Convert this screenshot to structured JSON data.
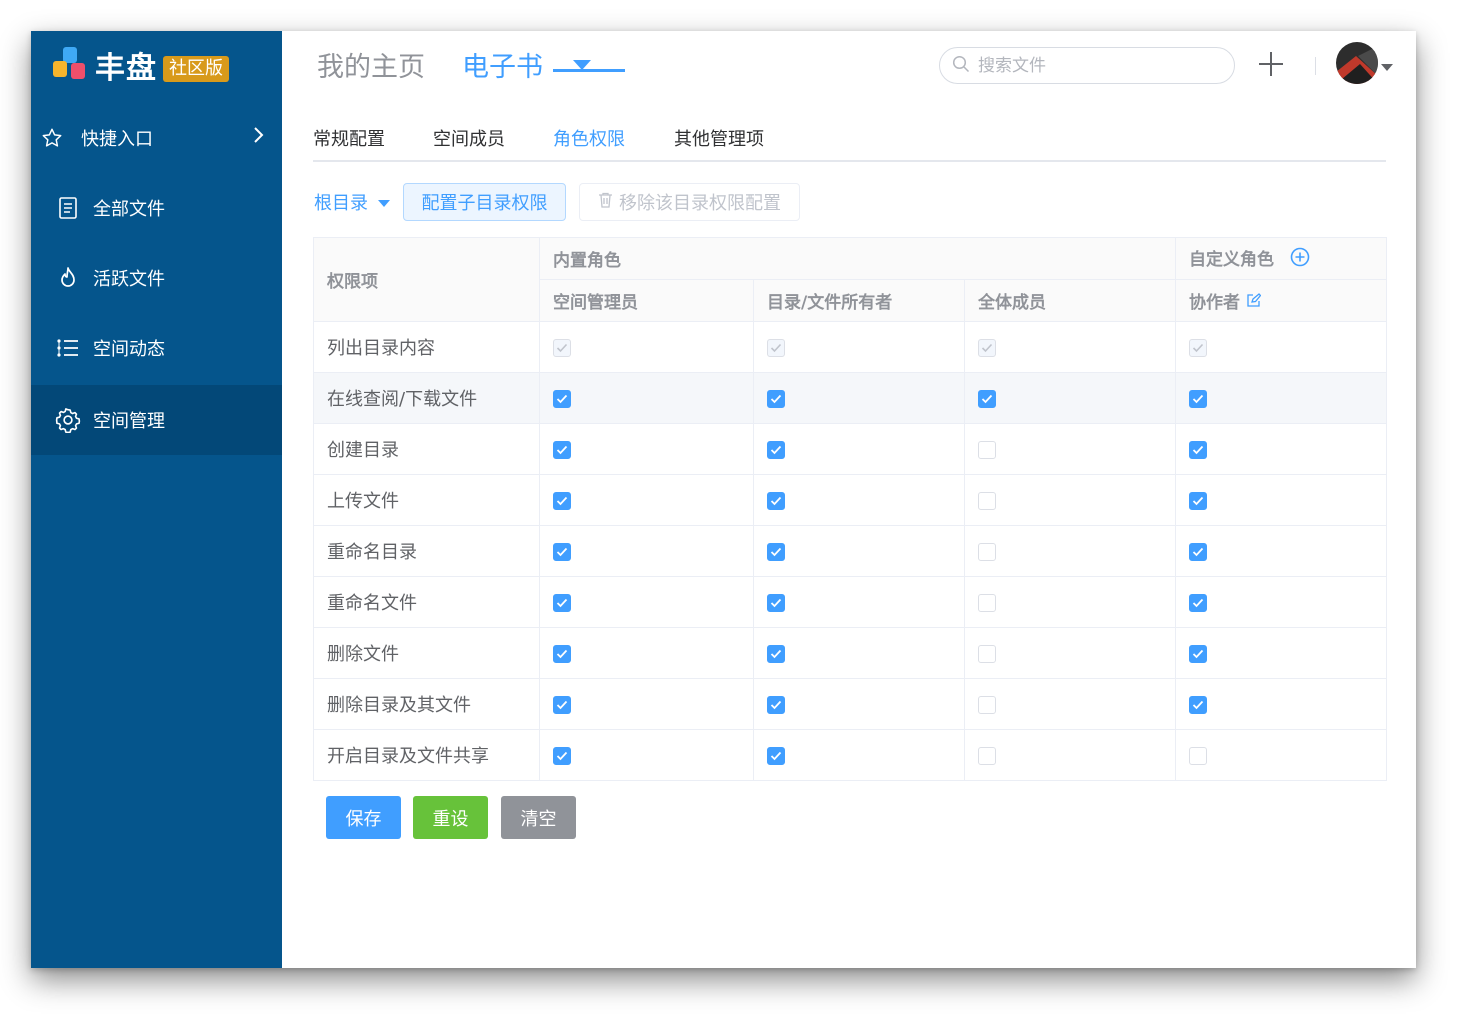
{
  "app": {
    "name": "丰盘",
    "edition_badge": "社区版"
  },
  "sidebar": {
    "quick_entry": "快捷入口",
    "items": [
      {
        "label": "全部文件",
        "icon": "document-icon"
      },
      {
        "label": "活跃文件",
        "icon": "flame-icon"
      },
      {
        "label": "空间动态",
        "icon": "timeline-list-icon"
      },
      {
        "label": "空间管理",
        "icon": "gear-icon",
        "active": true
      }
    ]
  },
  "header": {
    "home": "我的主页",
    "space": "电子书",
    "search_placeholder": "搜索文件"
  },
  "tabs": [
    "常规配置",
    "空间成员",
    "角色权限",
    "其他管理项"
  ],
  "active_tab": "角色权限",
  "toolbar": {
    "root": "根目录",
    "configure_button": "配置子目录权限",
    "remove_button": "移除该目录权限配置"
  },
  "table": {
    "header_permission": "权限项",
    "group_builtin": "内置角色",
    "group_custom": "自定义角色",
    "roles": [
      "空间管理员",
      "目录/文件所有者",
      "全体成员",
      "协作者"
    ],
    "rows": [
      {
        "label": "列出目录内容",
        "checks": [
          true,
          true,
          true,
          true
        ],
        "disabled": true
      },
      {
        "label": "在线查阅/下载文件",
        "checks": [
          true,
          true,
          true,
          true
        ]
      },
      {
        "label": "创建目录",
        "checks": [
          true,
          true,
          false,
          true
        ]
      },
      {
        "label": "上传文件",
        "checks": [
          true,
          true,
          false,
          true
        ]
      },
      {
        "label": "重命名目录",
        "checks": [
          true,
          true,
          false,
          true
        ]
      },
      {
        "label": "重命名文件",
        "checks": [
          true,
          true,
          false,
          true
        ]
      },
      {
        "label": "删除文件",
        "checks": [
          true,
          true,
          false,
          true
        ]
      },
      {
        "label": "删除目录及其文件",
        "checks": [
          true,
          true,
          false,
          true
        ]
      },
      {
        "label": "开启目录及文件共享",
        "checks": [
          true,
          true,
          false,
          false
        ]
      }
    ]
  },
  "actions": {
    "save": "保存",
    "reset": "重设",
    "clear": "清空"
  },
  "colors": {
    "sidebar": "#05558c",
    "accent": "#409eff",
    "save": "#409eff",
    "reset": "#67c23a",
    "clear": "#909399",
    "badge": "#d89a1b"
  }
}
